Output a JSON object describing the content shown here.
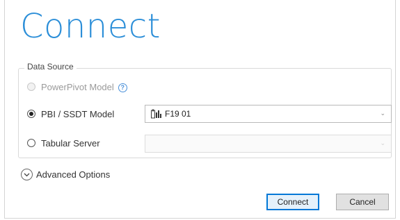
{
  "dialog": {
    "title": "Connect"
  },
  "data_source": {
    "group_label": "Data Source",
    "options": [
      {
        "label": "PowerPivot Model",
        "selected": false,
        "enabled": false
      },
      {
        "label": "PBI / SSDT Model",
        "selected": true,
        "enabled": true
      },
      {
        "label": "Tabular Server",
        "selected": false,
        "enabled": true
      }
    ],
    "pbi_model_value": "F19 01",
    "tabular_server_value": ""
  },
  "advanced": {
    "label": "Advanced Options"
  },
  "buttons": {
    "connect": "Connect",
    "cancel": "Cancel"
  },
  "colors": {
    "title": "#2b8ed8",
    "help_icon": "#4a90d9",
    "primary_button_border": "#0078d7"
  }
}
